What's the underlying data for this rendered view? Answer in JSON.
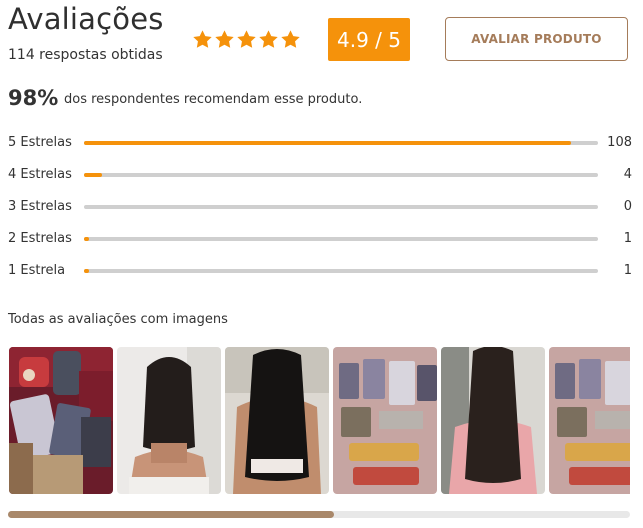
{
  "header": {
    "title": "Avaliações",
    "responses": "114 respostas obtidas",
    "score": "4.9 / 5",
    "rate_button": "AVALIAR PRODUTO",
    "stars_filled": 5,
    "star_color": "#f5920b"
  },
  "recommend": {
    "percent": "98%",
    "text": "dos respondentes recomendam esse produto."
  },
  "distribution": [
    {
      "label": "5 Estrelas",
      "count": "108",
      "fraction": 0.947
    },
    {
      "label": "4 Estrelas",
      "count": "4",
      "fraction": 0.035
    },
    {
      "label": "3 Estrelas",
      "count": "0",
      "fraction": 0
    },
    {
      "label": "2 Estrelas",
      "count": "1",
      "fraction": 0.009
    },
    {
      "label": "1 Estrela",
      "count": "1",
      "fraction": 0.009
    }
  ],
  "gallery": {
    "title": "Todas as avaliações com imagens",
    "images": [
      "product-box-photo",
      "short-hair-back-photo",
      "long-hair-back-photo",
      "products-on-floor-photo",
      "long-hair-pink-shirt-photo",
      "products-on-floor-photo"
    ]
  },
  "scroll": {
    "position_fraction": 0.525
  },
  "colors": {
    "accent": "#f5920b",
    "brand_brown": "#a57c5a",
    "track": "#cfcfcf"
  }
}
